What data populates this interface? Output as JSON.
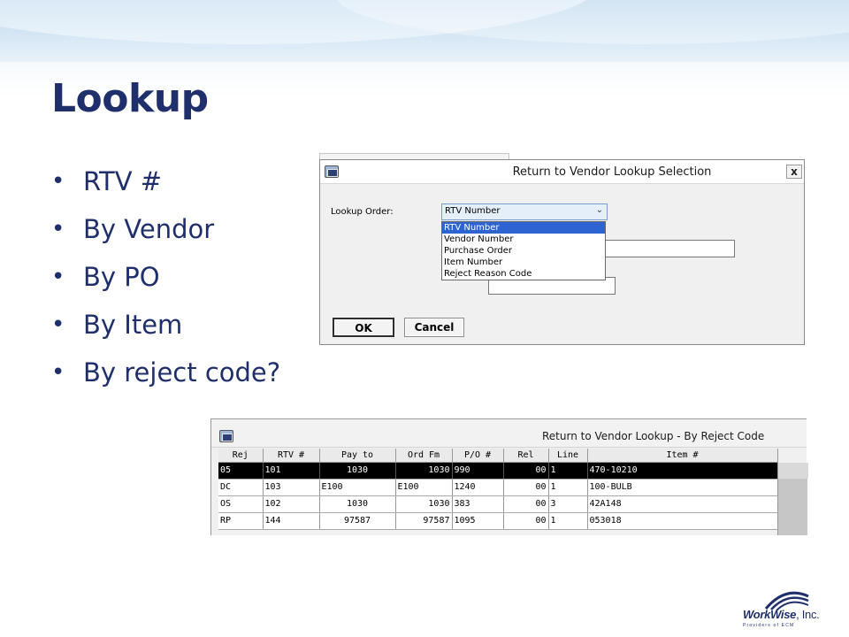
{
  "slide": {
    "title": "Lookup",
    "bullets": [
      "RTV #",
      "By Vendor",
      "By PO",
      "By Item",
      "By reject code?"
    ]
  },
  "lookup_dialog": {
    "title": "Return to Vendor Lookup Selection",
    "close_label": "x",
    "lookup_order_label": "Lookup Order:",
    "selected_value": "RTV Number",
    "options": [
      "RTV Number",
      "Vendor Number",
      "Purchase Order",
      "Item Number",
      "Reject Reason Code"
    ],
    "ok_label": "OK",
    "cancel_label": "Cancel"
  },
  "grid_window": {
    "title": "Return to Vendor Lookup - By Reject Code",
    "columns": [
      "Rej",
      "RTV #",
      "Pay to",
      "Ord Fm",
      "P/O #",
      "Rel",
      "Line",
      "Item #"
    ],
    "rows": [
      [
        "05",
        "101",
        "1030",
        "1030",
        "990",
        "00",
        "1",
        "470-10210"
      ],
      [
        "DC",
        "103",
        "E100",
        "E100",
        "1240",
        "00",
        "1",
        "100-BULB"
      ],
      [
        "OS",
        "102",
        "1030",
        "1030",
        "383",
        "00",
        "3",
        "42A148"
      ],
      [
        "RP",
        "144",
        "97587",
        "97587",
        "1095",
        "00",
        "1",
        "053018"
      ]
    ],
    "selected_row": 0
  },
  "logo": {
    "name": "WorkWise",
    "suffix": ", Inc.",
    "tagline": "Providers of ECM"
  }
}
